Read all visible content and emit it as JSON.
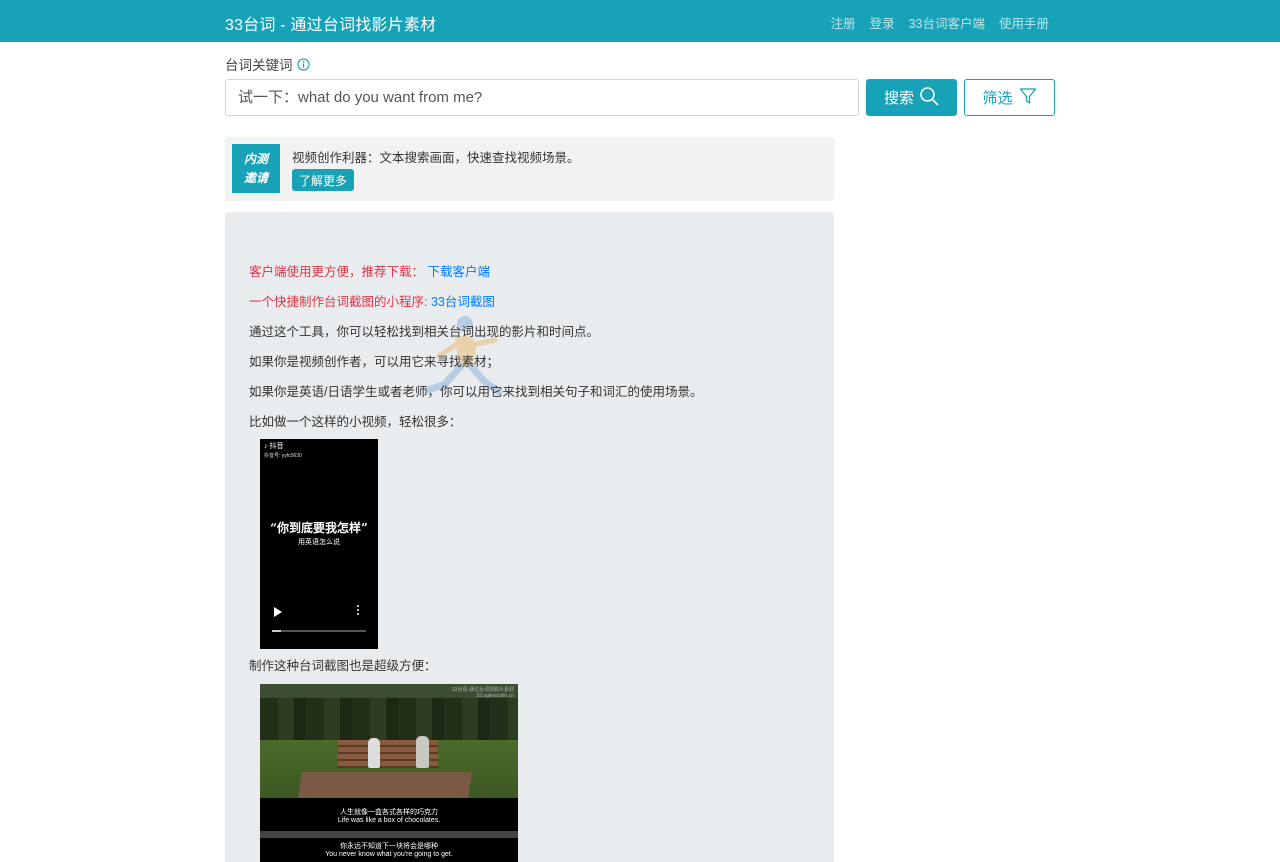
{
  "navbar": {
    "brand": "33台词 - 通过台词找影片素材",
    "links": [
      "注册",
      "登录",
      "33台词客户端",
      "使用手册"
    ]
  },
  "search": {
    "label": "台词关键词",
    "placeholder": "试一下：what do you want from me?",
    "search_button": "搜索",
    "filter_button": "筛选"
  },
  "beta": {
    "badge_line1": "内测",
    "badge_line2": "邀请",
    "text": "视频创作利器：文本搜索画面，快速查找视频场景。",
    "button": "了解更多"
  },
  "content": {
    "client_promo": "客户端使用更方便，推荐下载：",
    "client_link": "下载客户端",
    "mini_promo": "一个快捷制作台词截图的小程序:",
    "mini_link": "33台词截图",
    "p1": "通过这个工具，你可以轻松找到相关台词出现的影片和时间点。",
    "p2": "如果你是视频创作者，可以用它来寻找素材；",
    "p3": "如果你是英语/日语学生或者老师，你可以用它来找到相关句子和词汇的使用场景。",
    "p4": "比如做一个这样的小视频，轻松很多：",
    "p5": "制作这种台词截图也是超级方便："
  },
  "video": {
    "app_name": "抖音",
    "account": "抖音号: yyfc0630",
    "title": "“你到底要我怎样”",
    "subtitle": "用英语怎么说",
    "progress": 0.1
  },
  "still": {
    "watermark_line1": "33台词-通过台词找影片素材",
    "watermark_line2": "33.agilestudio.cn",
    "sub1_cn": "人生就像一盒各式各样的巧克力",
    "sub1_en": "Life was like a box of chocolates.",
    "sub2_cn": "你永远不知道下一块将会是哪种",
    "sub2_en": "You never know what you're going to get."
  }
}
